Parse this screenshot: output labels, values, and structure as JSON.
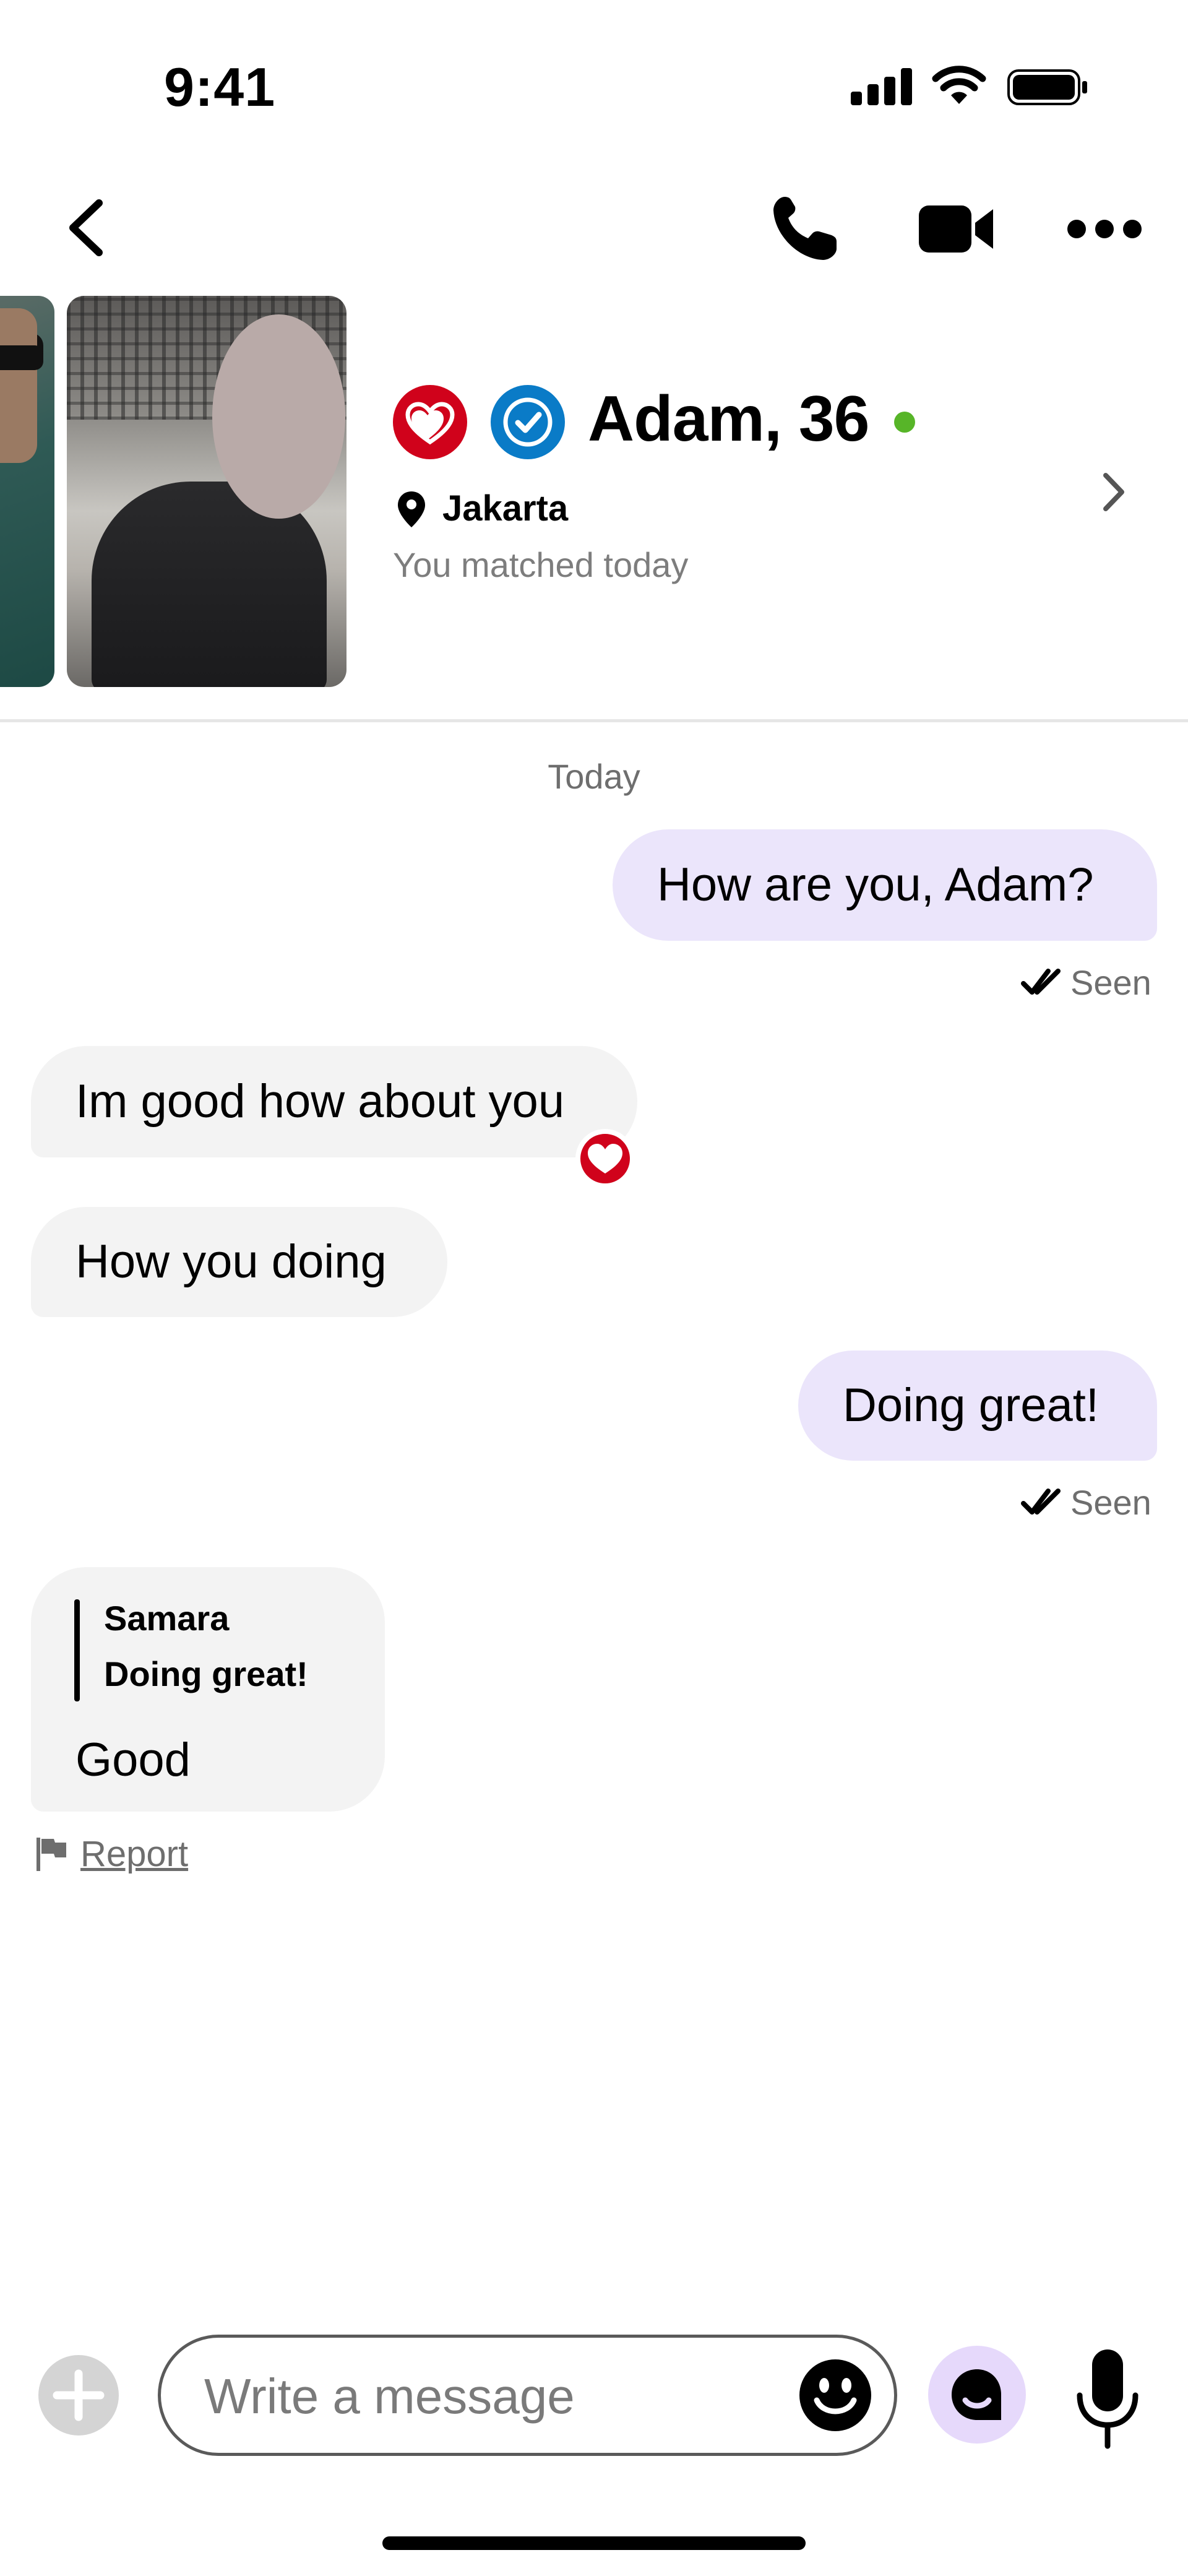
{
  "status_bar": {
    "time": "9:41"
  },
  "profile": {
    "name_age": "Adam, 36",
    "location": "Jakarta",
    "matched_text": "You matched today"
  },
  "chat": {
    "day_label": "Today",
    "messages": [
      {
        "sender": "me",
        "text": "How are you, Adam?",
        "status": "Seen"
      },
      {
        "sender": "them",
        "text": "Im good how about you",
        "reaction": "heart"
      },
      {
        "sender": "them",
        "text": "How you doing"
      },
      {
        "sender": "me",
        "text": "Doing great!",
        "status": "Seen"
      },
      {
        "sender": "them",
        "text": "Good",
        "quote": {
          "author": "Samara",
          "text": "Doing great!"
        }
      }
    ],
    "report_label": "Report"
  },
  "composer": {
    "placeholder": "Write a message"
  },
  "colors": {
    "accent_red": "#d0021b",
    "verified_blue": "#0a7bc7",
    "online_green": "#57b528",
    "my_bubble": "#ebe5fb",
    "their_bubble": "#f3f3f3"
  }
}
